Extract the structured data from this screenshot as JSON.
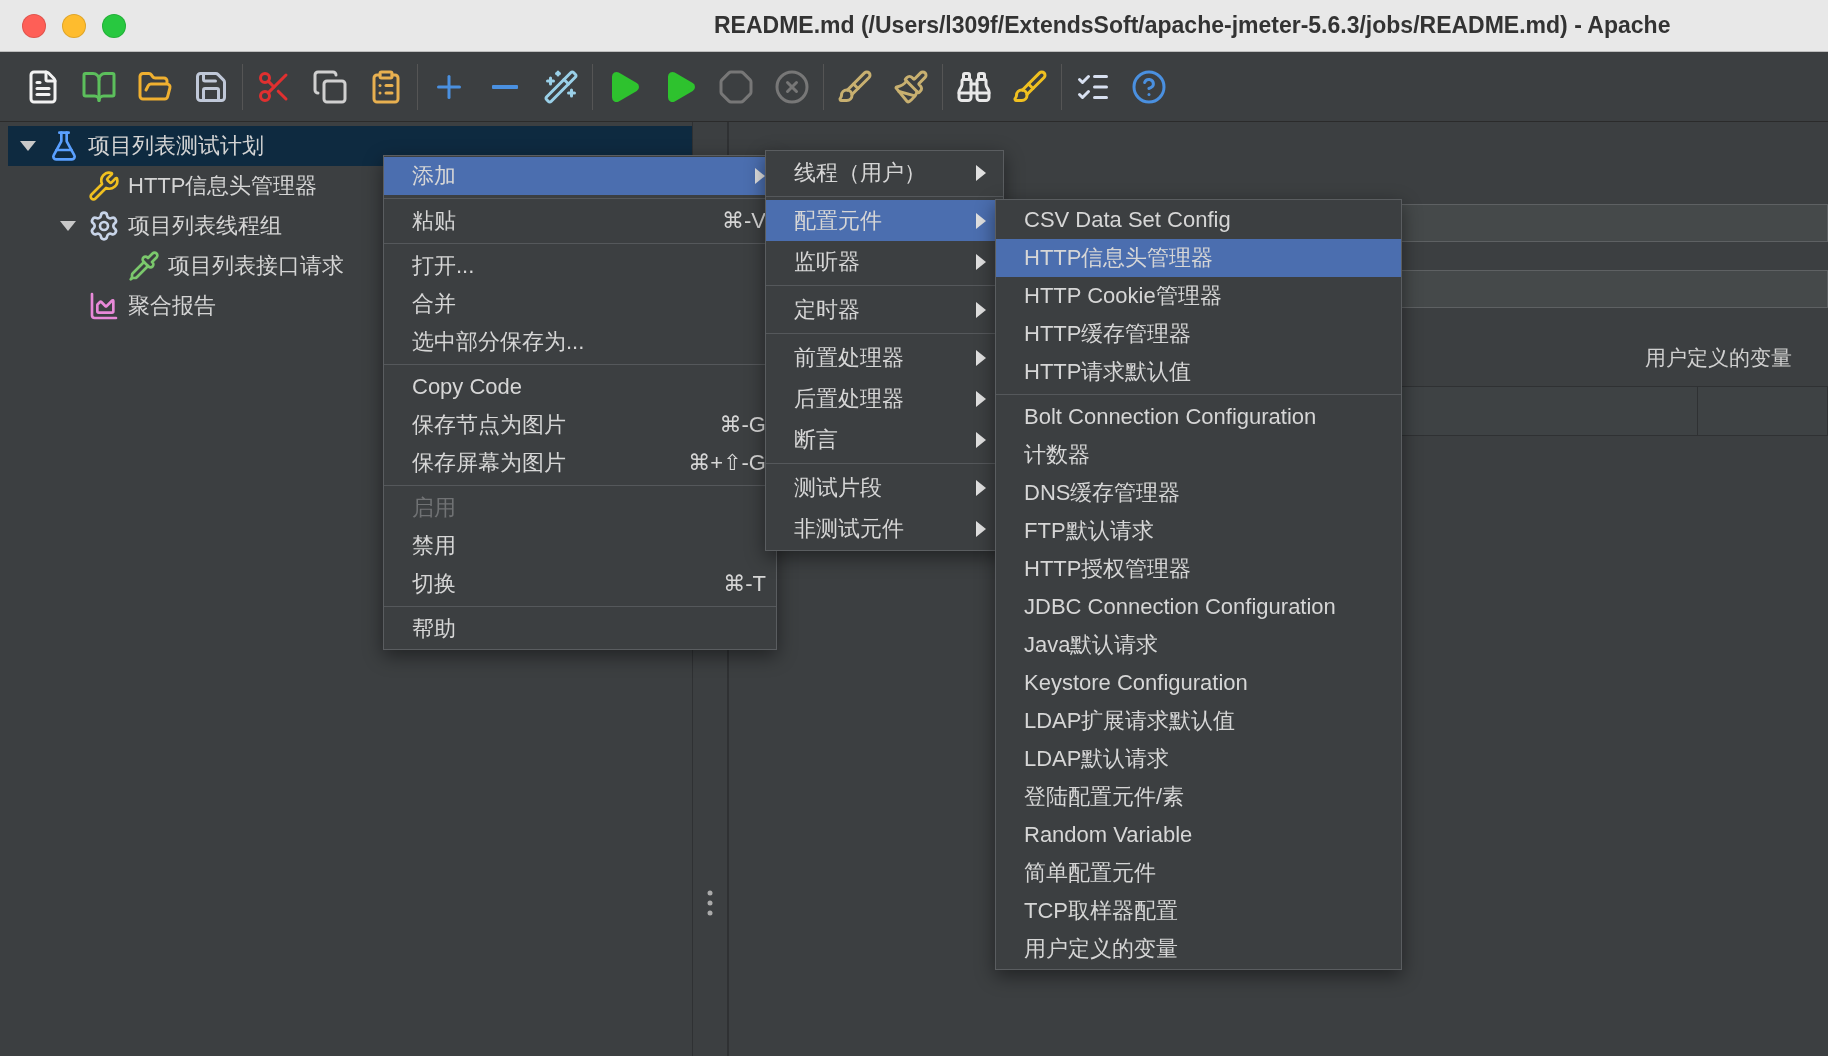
{
  "window": {
    "title": "README.md (/Users/l309f/ExtendsSoft/apache-jmeter-5.6.3/jobs/README.md) - Apache"
  },
  "tree": [
    {
      "label": "项目列表测试计划",
      "kind": "plan",
      "selected": true,
      "expanded": true,
      "children": [
        {
          "label": "HTTP信息头管理器",
          "kind": "config",
          "selected": false
        },
        {
          "label": "项目列表线程组",
          "kind": "thread-group",
          "selected": false,
          "expanded": true,
          "children": [
            {
              "label": "项目列表接口请求",
              "kind": "sampler",
              "selected": false
            }
          ]
        },
        {
          "label": "聚合报告",
          "kind": "listener",
          "selected": false
        }
      ]
    }
  ],
  "right_panel": {
    "variables_label": "用户定义的变量"
  },
  "context_menu": {
    "groups": [
      [
        {
          "label": "添加",
          "selected": true,
          "disabled": false,
          "submenu": true
        }
      ],
      [
        {
          "label": "粘贴",
          "shortcut": "⌘-V",
          "selected": false,
          "disabled": false,
          "submenu": false
        }
      ],
      [
        {
          "label": "打开...",
          "selected": false,
          "disabled": false,
          "submenu": false
        },
        {
          "label": "合并",
          "selected": false,
          "disabled": false,
          "submenu": false
        },
        {
          "label": "选中部分保存为...",
          "selected": false,
          "disabled": false,
          "submenu": false
        }
      ],
      [
        {
          "label": "Copy Code",
          "selected": false,
          "disabled": false,
          "submenu": false
        },
        {
          "label": "保存节点为图片",
          "shortcut": "⌘-G",
          "selected": false,
          "disabled": false,
          "submenu": false
        },
        {
          "label": "保存屏幕为图片",
          "shortcut": "⌘+⇧-G",
          "selected": false,
          "disabled": false,
          "submenu": false
        }
      ],
      [
        {
          "label": "启用",
          "selected": false,
          "disabled": true,
          "submenu": false
        },
        {
          "label": "禁用",
          "selected": false,
          "disabled": false,
          "submenu": false
        },
        {
          "label": "切换",
          "shortcut": "⌘-T",
          "selected": false,
          "disabled": false,
          "submenu": false
        }
      ],
      [
        {
          "label": "帮助",
          "selected": false,
          "disabled": false,
          "submenu": false
        }
      ]
    ]
  },
  "add_submenu": {
    "groups": [
      [
        {
          "label": "线程（用户）",
          "selected": false,
          "submenu": true
        }
      ],
      [
        {
          "label": "配置元件",
          "selected": true,
          "submenu": true
        },
        {
          "label": "监听器",
          "selected": false,
          "submenu": true
        }
      ],
      [
        {
          "label": "定时器",
          "selected": false,
          "submenu": true
        }
      ],
      [
        {
          "label": "前置处理器",
          "selected": false,
          "submenu": true
        },
        {
          "label": "后置处理器",
          "selected": false,
          "submenu": true
        },
        {
          "label": "断言",
          "selected": false,
          "submenu": true
        }
      ],
      [
        {
          "label": "测试片段",
          "selected": false,
          "submenu": true
        },
        {
          "label": "非测试元件",
          "selected": false,
          "submenu": true
        }
      ]
    ]
  },
  "config_submenu": {
    "groups": [
      [
        {
          "label": "CSV Data Set Config",
          "selected": false
        },
        {
          "label": "HTTP信息头管理器",
          "selected": true
        },
        {
          "label": "HTTP Cookie管理器",
          "selected": false
        },
        {
          "label": "HTTP缓存管理器",
          "selected": false
        },
        {
          "label": "HTTP请求默认值",
          "selected": false
        }
      ],
      [
        {
          "label": "Bolt Connection Configuration",
          "selected": false
        },
        {
          "label": "计数器",
          "selected": false
        },
        {
          "label": "DNS缓存管理器",
          "selected": false
        },
        {
          "label": "FTP默认请求",
          "selected": false
        },
        {
          "label": "HTTP授权管理器",
          "selected": false
        },
        {
          "label": "JDBC Connection Configuration",
          "selected": false
        },
        {
          "label": "Java默认请求",
          "selected": false
        },
        {
          "label": "Keystore Configuration",
          "selected": false
        },
        {
          "label": "LDAP扩展请求默认值",
          "selected": false
        },
        {
          "label": "LDAP默认请求",
          "selected": false
        },
        {
          "label": "登陆配置元件/素",
          "selected": false
        },
        {
          "label": "Random Variable",
          "selected": false
        },
        {
          "label": "简单配置元件",
          "selected": false
        },
        {
          "label": "TCP取样器配置",
          "selected": false
        },
        {
          "label": "用户定义的变量",
          "selected": false
        }
      ]
    ]
  }
}
